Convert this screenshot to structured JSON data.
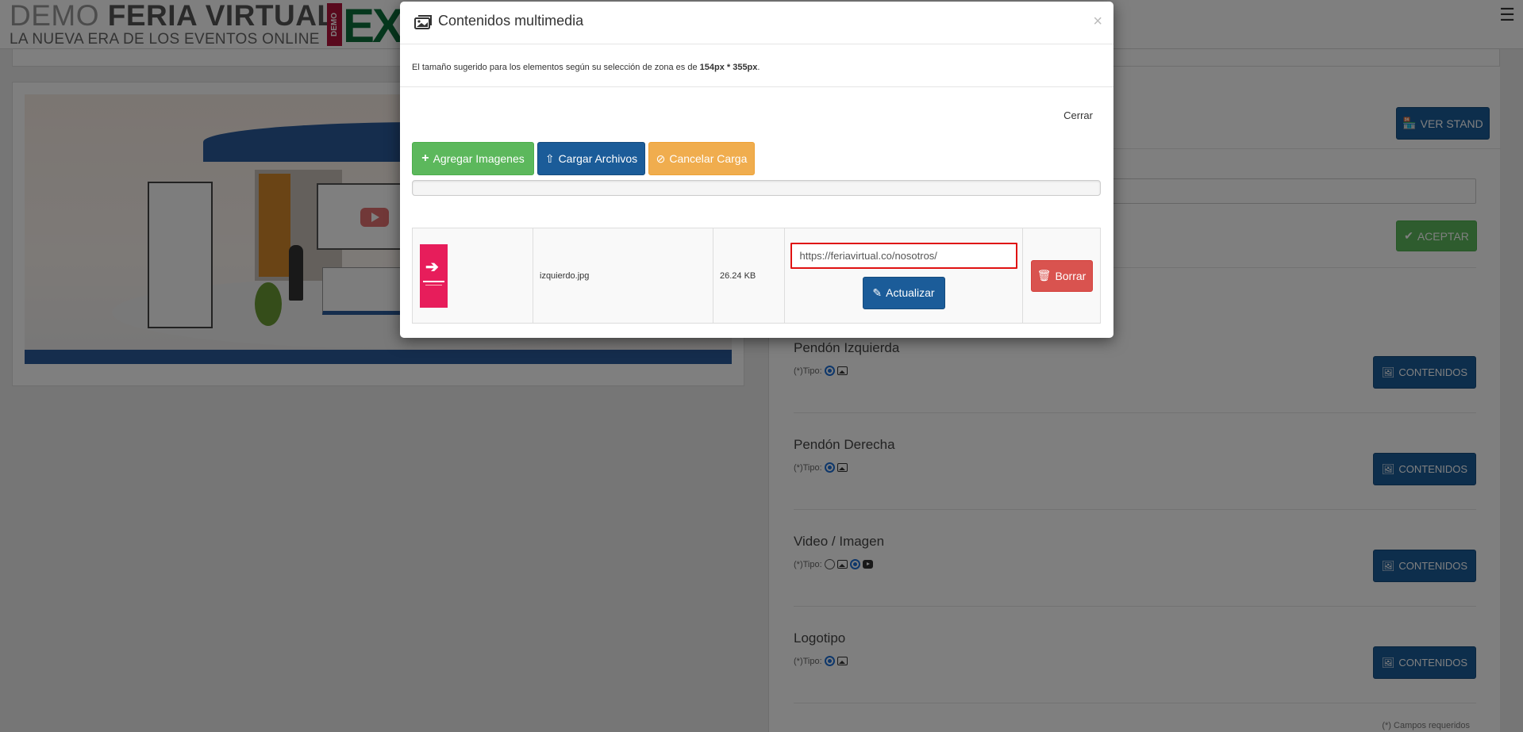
{
  "header": {
    "brand_light": "DEMO",
    "brand_bold": "FERIA VIRTUAL",
    "tagline": "LA NUEVA ERA DE LOS EVENTOS ONLINE",
    "expo_demo": "DEMO",
    "expo_text": "EX",
    "menu_icon": "hamburger-menu-icon"
  },
  "right_panel": {
    "ver_stand_label": "VER STAND",
    "aceptar_label": "ACEPTAR",
    "contents_button_label": "CONTENIDOS",
    "tipo_label": "(*)Tipo:",
    "required_note": "(*) Campos requeridos",
    "sections": [
      {
        "title": "Pendón Izquierda"
      },
      {
        "title": "Pendón Derecha"
      },
      {
        "title": "Video / Imagen"
      },
      {
        "title": "Logotipo"
      }
    ]
  },
  "modal": {
    "title": "Contenidos multimedia",
    "note_prefix": "El tamaño sugerido para los elementos según su selección de zona es de ",
    "note_size": "154px * 355px",
    "note_suffix": ".",
    "close_symbol": "×",
    "cerrar_label": "Cerrar",
    "add_images_label": "Agregar Imagenes",
    "upload_files_label": "Cargar Archivos",
    "cancel_upload_label": "Cancelar Carga",
    "upload_progress": 0,
    "files": [
      {
        "thumbnail_icon": "arrow-logo-thumbnail",
        "filename": "izquierdo.jpg",
        "size": "26.24 KB",
        "url": "https://feriavirtual.co/nosotros/",
        "update_label": "Actualizar",
        "delete_label": "Borrar"
      }
    ]
  },
  "colors": {
    "primary": "#1b5c99",
    "success": "#5cb85c",
    "warning": "#f0ad4e",
    "danger": "#d9534f",
    "highlight_border": "#e01212"
  }
}
